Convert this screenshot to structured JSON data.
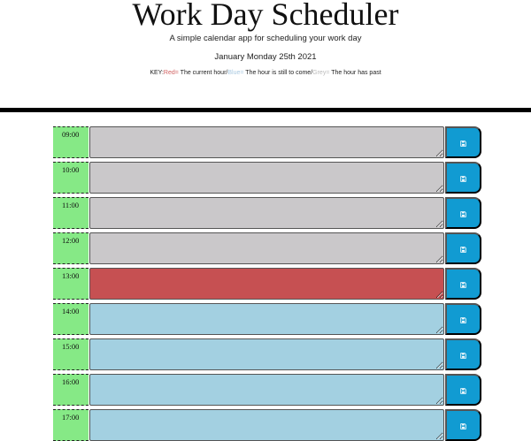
{
  "header": {
    "title": "Work Day Scheduler",
    "subtitle": "A simple calendar app for scheduling your work day",
    "date": "January Monday 25th 2021",
    "key": {
      "prefix": "KEY:",
      "red_label": "Red=",
      "red_text": " The current hour/",
      "blue_label": "Blue=",
      "blue_text": " The hour is still to come/",
      "grey_label": "Grey=",
      "grey_text": " The hour has past"
    }
  },
  "colors": {
    "past": "#cac8ca",
    "present": "#c65052",
    "future": "#a3d0e1",
    "hour_block": "#86e986",
    "save_button": "#119bd2"
  },
  "rows": [
    {
      "hour": "09:00",
      "state": "past",
      "text": "",
      "save_icon": "save-icon"
    },
    {
      "hour": "10:00",
      "state": "past",
      "text": "",
      "save_icon": "save-icon"
    },
    {
      "hour": "11:00",
      "state": "past",
      "text": "",
      "save_icon": "save-icon"
    },
    {
      "hour": "12:00",
      "state": "past",
      "text": "",
      "save_icon": "save-icon"
    },
    {
      "hour": "13:00",
      "state": "present",
      "text": "",
      "save_icon": "save-icon"
    },
    {
      "hour": "14:00",
      "state": "future",
      "text": "",
      "save_icon": "save-icon"
    },
    {
      "hour": "15:00",
      "state": "future",
      "text": "",
      "save_icon": "save-icon"
    },
    {
      "hour": "16:00",
      "state": "future",
      "text": "",
      "save_icon": "save-icon"
    },
    {
      "hour": "17:00",
      "state": "future",
      "text": "",
      "save_icon": "save-icon"
    }
  ]
}
